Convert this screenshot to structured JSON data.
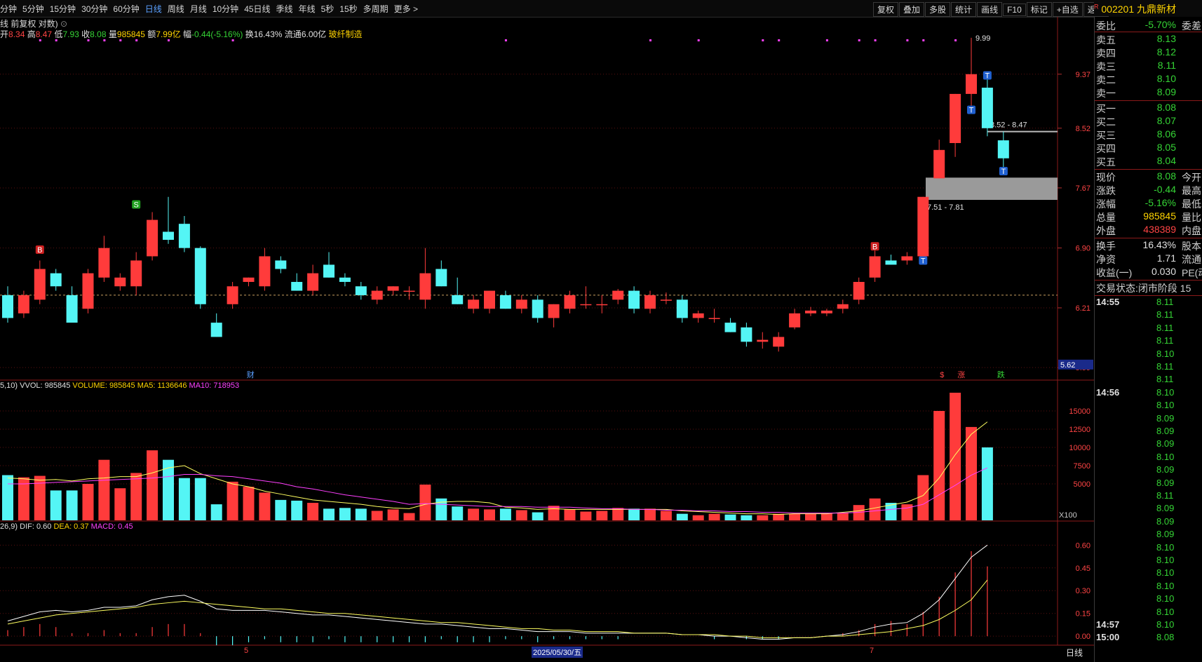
{
  "toolbar": {
    "periods": [
      "分钟",
      "5分钟",
      "15分钟",
      "30分钟",
      "60分钟",
      "日线",
      "周线",
      "月线",
      "10分钟",
      "45日线",
      "季线",
      "年线",
      "5秒",
      "15秒",
      "多周期",
      "更多 >"
    ],
    "active_period": "日线",
    "tools": [
      "复权",
      "叠加",
      "多股",
      "统计",
      "画线",
      "F10",
      "标记",
      "+自选",
      "返回"
    ]
  },
  "stock": {
    "code": "002201",
    "name": "九鼎新材",
    "badge": "R"
  },
  "chart_header": {
    "title": "线 前复权 对数)",
    "open_label": "开",
    "open": "8.34",
    "high_label": "高",
    "high": "8.47",
    "low_label": "低",
    "low": "7.93",
    "close_label": "收",
    "close": "8.08",
    "vol_label": "量",
    "vol": "985845",
    "amt_label": "额",
    "amt": "7.99亿",
    "chg_label": "幅",
    "chg": "-0.44(-5.16%)",
    "turn_label": "换",
    "turn": "16.43%",
    "float_label": "流通",
    "float": "6.00亿",
    "sector": "玻纤制造"
  },
  "vol_header": {
    "prefix": "5,10)",
    "vvol": "VVOL: 985845",
    "volume": "VOLUME: 985845",
    "ma5": "MA5: 1136646",
    "ma10": "MA10: 718953"
  },
  "macd_header": {
    "prefix": "26,9)",
    "dif": "DIF: 0.60",
    "dea": "DEA: 0.37",
    "macd": "MACD: 0.45"
  },
  "price_axis": [
    "9.37",
    "8.52",
    "7.67",
    "6.90",
    "6.21",
    "5.59"
  ],
  "price_marker": "5.62",
  "vol_axis": [
    "15000",
    "12500",
    "10000",
    "7500",
    "5000"
  ],
  "vol_unit": "X100",
  "macd_axis": [
    "0.60",
    "0.45",
    "0.30",
    "0.15",
    "0.00"
  ],
  "annotations": {
    "peak": "9.99",
    "zone_upper": "8.52 - 8.47",
    "zone_lower": "7.51 - 7.81",
    "markers_bottom": [
      "财",
      "$",
      "涨",
      "跌"
    ]
  },
  "x_labels": [
    "5",
    "2025/05/30/五",
    "7"
  ],
  "bottom_tabs_right": "日线",
  "quote": {
    "weibi_label": "委比",
    "weibi": "-5.70%",
    "weicha_label": "委差",
    "asks": [
      {
        "label": "卖五",
        "price": "8.13"
      },
      {
        "label": "卖四",
        "price": "8.12"
      },
      {
        "label": "卖三",
        "price": "8.11"
      },
      {
        "label": "卖二",
        "price": "8.10"
      },
      {
        "label": "卖一",
        "price": "8.09"
      }
    ],
    "bids": [
      {
        "label": "买一",
        "price": "8.08"
      },
      {
        "label": "买二",
        "price": "8.07"
      },
      {
        "label": "买三",
        "price": "8.06"
      },
      {
        "label": "买四",
        "price": "8.05"
      },
      {
        "label": "买五",
        "price": "8.04"
      }
    ],
    "stats": [
      {
        "label": "现价",
        "value": "8.08",
        "color": "#35d435",
        "right": "今开"
      },
      {
        "label": "涨跌",
        "value": "-0.44",
        "color": "#35d435",
        "right": "最高"
      },
      {
        "label": "涨幅",
        "value": "-5.16%",
        "color": "#35d435",
        "right": "最低"
      },
      {
        "label": "总量",
        "value": "985845",
        "color": "#ffd400",
        "right": "量比"
      },
      {
        "label": "外盘",
        "value": "438389",
        "color": "#ff4444",
        "right": "内盘"
      }
    ],
    "stats2": [
      {
        "label": "换手",
        "value": "16.43%",
        "color": "#e0e0e0",
        "right": "股本"
      },
      {
        "label": "净资",
        "value": "1.71",
        "color": "#e0e0e0",
        "right": "流通"
      },
      {
        "label": "收益(一)",
        "value": "0.030",
        "color": "#e0e0e0",
        "right": "PE(动"
      }
    ],
    "trade_status_label": "交易状态:",
    "trade_status": "闭市阶段 15"
  },
  "ticks": [
    {
      "time": "14:55",
      "price": "8.11"
    },
    {
      "time": "",
      "price": "8.11"
    },
    {
      "time": "",
      "price": "8.11"
    },
    {
      "time": "",
      "price": "8.11"
    },
    {
      "time": "",
      "price": "8.10"
    },
    {
      "time": "",
      "price": "8.11"
    },
    {
      "time": "",
      "price": "8.11"
    },
    {
      "time": "14:56",
      "price": "8.10"
    },
    {
      "time": "",
      "price": "8.10"
    },
    {
      "time": "",
      "price": "8.09"
    },
    {
      "time": "",
      "price": "8.09"
    },
    {
      "time": "",
      "price": "8.09"
    },
    {
      "time": "",
      "price": "8.10"
    },
    {
      "time": "",
      "price": "8.09"
    },
    {
      "time": "",
      "price": "8.09"
    },
    {
      "time": "",
      "price": "8.11"
    },
    {
      "time": "",
      "price": "8.09"
    },
    {
      "time": "",
      "price": "8.09"
    },
    {
      "time": "",
      "price": "8.09"
    },
    {
      "time": "",
      "price": "8.10"
    },
    {
      "time": "",
      "price": "8.10"
    },
    {
      "time": "",
      "price": "8.10"
    },
    {
      "time": "",
      "price": "8.10"
    },
    {
      "time": "",
      "price": "8.10"
    },
    {
      "time": "",
      "price": "8.10"
    },
    {
      "time": "14:57",
      "price": "8.10"
    },
    {
      "time": "15:00",
      "price": "8.08"
    }
  ],
  "chart_data": {
    "type": "candlestick",
    "candles": [
      {
        "o": 6.35,
        "h": 6.45,
        "l": 6.05,
        "c": 6.1
      },
      {
        "o": 6.15,
        "h": 6.4,
        "l": 6.1,
        "c": 6.35
      },
      {
        "o": 6.3,
        "h": 6.75,
        "l": 6.25,
        "c": 6.65
      },
      {
        "o": 6.6,
        "h": 6.65,
        "l": 6.4,
        "c": 6.45
      },
      {
        "o": 6.35,
        "h": 6.45,
        "l": 6.1,
        "c": 6.05
      },
      {
        "o": 6.2,
        "h": 6.65,
        "l": 6.15,
        "c": 6.6
      },
      {
        "o": 6.55,
        "h": 7.05,
        "l": 6.5,
        "c": 6.9
      },
      {
        "o": 6.45,
        "h": 6.6,
        "l": 6.4,
        "c": 6.55
      },
      {
        "o": 6.45,
        "h": 6.85,
        "l": 6.35,
        "c": 6.75
      },
      {
        "o": 6.8,
        "h": 7.35,
        "l": 6.75,
        "c": 7.25
      },
      {
        "o": 7.1,
        "h": 7.55,
        "l": 6.95,
        "c": 7.0
      },
      {
        "o": 7.2,
        "h": 7.3,
        "l": 6.85,
        "c": 6.9
      },
      {
        "o": 6.9,
        "h": 6.92,
        "l": 6.2,
        "c": 6.25
      },
      {
        "o": 6.05,
        "h": 6.15,
        "l": 5.9,
        "c": 5.9
      },
      {
        "o": 6.25,
        "h": 6.5,
        "l": 6.2,
        "c": 6.45
      },
      {
        "o": 6.5,
        "h": 6.55,
        "l": 6.45,
        "c": 6.55
      },
      {
        "o": 6.45,
        "h": 6.9,
        "l": 6.4,
        "c": 6.8
      },
      {
        "o": 6.75,
        "h": 6.8,
        "l": 6.6,
        "c": 6.65
      },
      {
        "o": 6.5,
        "h": 6.6,
        "l": 6.4,
        "c": 6.4
      },
      {
        "o": 6.4,
        "h": 6.7,
        "l": 6.35,
        "c": 6.6
      },
      {
        "o": 6.7,
        "h": 6.85,
        "l": 6.55,
        "c": 6.55
      },
      {
        "o": 6.55,
        "h": 6.6,
        "l": 6.45,
        "c": 6.5
      },
      {
        "o": 6.45,
        "h": 6.5,
        "l": 6.3,
        "c": 6.35
      },
      {
        "o": 6.3,
        "h": 6.45,
        "l": 6.25,
        "c": 6.4
      },
      {
        "o": 6.4,
        "h": 6.45,
        "l": 6.35,
        "c": 6.45
      },
      {
        "o": 6.4,
        "h": 6.45,
        "l": 6.3,
        "c": 6.4
      },
      {
        "o": 6.3,
        "h": 6.9,
        "l": 6.2,
        "c": 6.6
      },
      {
        "o": 6.65,
        "h": 6.75,
        "l": 6.45,
        "c": 6.45
      },
      {
        "o": 6.35,
        "h": 6.55,
        "l": 6.25,
        "c": 6.25
      },
      {
        "o": 6.2,
        "h": 6.35,
        "l": 6.15,
        "c": 6.3
      },
      {
        "o": 6.2,
        "h": 6.4,
        "l": 6.15,
        "c": 6.4
      },
      {
        "o": 6.35,
        "h": 6.4,
        "l": 6.2,
        "c": 6.2
      },
      {
        "o": 6.2,
        "h": 6.35,
        "l": 6.15,
        "c": 6.3
      },
      {
        "o": 6.3,
        "h": 6.35,
        "l": 6.05,
        "c": 6.1
      },
      {
        "o": 6.1,
        "h": 6.25,
        "l": 6.0,
        "c": 6.25
      },
      {
        "o": 6.2,
        "h": 6.4,
        "l": 6.15,
        "c": 6.35
      },
      {
        "o": 6.25,
        "h": 6.45,
        "l": 6.2,
        "c": 6.25
      },
      {
        "o": 6.25,
        "h": 6.35,
        "l": 6.15,
        "c": 6.25
      },
      {
        "o": 6.3,
        "h": 6.42,
        "l": 6.25,
        "c": 6.4
      },
      {
        "o": 6.4,
        "h": 6.45,
        "l": 6.15,
        "c": 6.2
      },
      {
        "o": 6.2,
        "h": 6.4,
        "l": 6.15,
        "c": 6.35
      },
      {
        "o": 6.3,
        "h": 6.38,
        "l": 6.25,
        "c": 6.3
      },
      {
        "o": 6.3,
        "h": 6.35,
        "l": 6.05,
        "c": 6.1
      },
      {
        "o": 6.1,
        "h": 6.18,
        "l": 6.05,
        "c": 6.15
      },
      {
        "o": 6.1,
        "h": 6.2,
        "l": 6.05,
        "c": 6.1
      },
      {
        "o": 6.05,
        "h": 6.1,
        "l": 5.95,
        "c": 5.95
      },
      {
        "o": 6.0,
        "h": 6.05,
        "l": 5.8,
        "c": 5.85
      },
      {
        "o": 5.85,
        "h": 5.95,
        "l": 5.78,
        "c": 5.87
      },
      {
        "o": 5.8,
        "h": 5.95,
        "l": 5.75,
        "c": 5.9
      },
      {
        "o": 6.0,
        "h": 6.2,
        "l": 5.98,
        "c": 6.15
      },
      {
        "o": 6.15,
        "h": 6.22,
        "l": 6.12,
        "c": 6.18
      },
      {
        "o": 6.15,
        "h": 6.2,
        "l": 6.12,
        "c": 6.18
      },
      {
        "o": 6.2,
        "h": 6.3,
        "l": 6.15,
        "c": 6.25
      },
      {
        "o": 6.3,
        "h": 6.55,
        "l": 6.25,
        "c": 6.5
      },
      {
        "o": 6.55,
        "h": 6.9,
        "l": 6.5,
        "c": 6.8
      },
      {
        "o": 6.75,
        "h": 6.82,
        "l": 6.7,
        "c": 6.7
      },
      {
        "o": 6.75,
        "h": 6.85,
        "l": 6.7,
        "c": 6.8
      },
      {
        "o": 6.8,
        "h": 7.55,
        "l": 6.7,
        "c": 7.55
      },
      {
        "o": 7.8,
        "h": 8.35,
        "l": 7.8,
        "c": 8.2
      },
      {
        "o": 8.3,
        "h": 9.05,
        "l": 8.1,
        "c": 9.05
      },
      {
        "o": 9.05,
        "h": 9.99,
        "l": 8.75,
        "c": 9.37
      },
      {
        "o": 9.15,
        "h": 9.35,
        "l": 8.4,
        "c": 8.52
      },
      {
        "o": 8.34,
        "h": 8.47,
        "l": 7.93,
        "c": 8.08
      }
    ],
    "volumes": [
      6200,
      5900,
      6100,
      4100,
      4100,
      5000,
      8300,
      4400,
      6500,
      9600,
      8300,
      5800,
      5800,
      2200,
      5300,
      4600,
      3800,
      2800,
      2700,
      2400,
      1600,
      1700,
      1600,
      1300,
      1500,
      1000,
      4900,
      3000,
      1900,
      1600,
      1500,
      1600,
      1400,
      1100,
      2000,
      1500,
      1200,
      1300,
      1700,
      1600,
      1600,
      1300,
      900,
      700,
      900,
      800,
      700,
      700,
      900,
      900,
      900,
      1000,
      1000,
      2100,
      3000,
      2400,
      2200,
      6200,
      15000,
      17500,
      12800,
      10000
    ],
    "vol_ma5": [
      5800,
      5700,
      5500,
      5600,
      5400,
      5700,
      5800,
      6000,
      6000,
      6500,
      7200,
      7500,
      6400,
      5700,
      5000,
      4600,
      4000,
      3600,
      3200,
      2800,
      2600,
      2400,
      2200,
      1900,
      1700,
      1600,
      2200,
      2500,
      2600,
      2600,
      2400,
      1800,
      1700,
      1500,
      1600,
      1500,
      1500,
      1500,
      1500,
      1500,
      1500,
      1500,
      1300,
      1200,
      1100,
      1000,
      900,
      900,
      800,
      900,
      900,
      900,
      1100,
      1300,
      1700,
      2100,
      2500,
      3400,
      5800,
      9000,
      11800,
      13500
    ],
    "vol_ma10": [
      5000,
      5000,
      5100,
      5200,
      5300,
      5400,
      5500,
      5600,
      5700,
      5800,
      6000,
      6300,
      6300,
      6100,
      6000,
      5700,
      5400,
      5100,
      4600,
      4300,
      3900,
      3500,
      3200,
      2900,
      2600,
      2200,
      2300,
      2200,
      2100,
      2000,
      1900,
      1900,
      1900,
      1800,
      1800,
      1800,
      1700,
      1600,
      1600,
      1500,
      1500,
      1400,
      1400,
      1300,
      1300,
      1200,
      1200,
      1100,
      1100,
      1000,
      1000,
      1000,
      1000,
      1100,
      1300,
      1500,
      1700,
      2200,
      3500,
      4800,
      6200,
      7200
    ],
    "macd_dif": [
      0.1,
      0.13,
      0.16,
      0.17,
      0.16,
      0.17,
      0.19,
      0.19,
      0.2,
      0.24,
      0.26,
      0.27,
      0.23,
      0.18,
      0.17,
      0.17,
      0.17,
      0.16,
      0.15,
      0.14,
      0.14,
      0.13,
      0.12,
      0.11,
      0.1,
      0.09,
      0.08,
      0.08,
      0.07,
      0.06,
      0.05,
      0.05,
      0.04,
      0.03,
      0.03,
      0.03,
      0.02,
      0.02,
      0.02,
      0.02,
      0.02,
      0.02,
      0.01,
      0.01,
      0.0,
      0.0,
      -0.01,
      -0.02,
      -0.02,
      -0.01,
      -0.01,
      0.0,
      0.01,
      0.03,
      0.06,
      0.08,
      0.09,
      0.15,
      0.24,
      0.38,
      0.52,
      0.6
    ],
    "macd_dea": [
      0.08,
      0.1,
      0.12,
      0.14,
      0.15,
      0.16,
      0.17,
      0.18,
      0.19,
      0.21,
      0.22,
      0.23,
      0.22,
      0.21,
      0.2,
      0.19,
      0.18,
      0.18,
      0.17,
      0.16,
      0.15,
      0.15,
      0.14,
      0.13,
      0.12,
      0.11,
      0.1,
      0.09,
      0.09,
      0.08,
      0.07,
      0.06,
      0.05,
      0.05,
      0.04,
      0.04,
      0.03,
      0.03,
      0.03,
      0.02,
      0.02,
      0.02,
      0.01,
      0.01,
      0.01,
      0.0,
      0.0,
      -0.01,
      -0.01,
      -0.01,
      -0.01,
      0.0,
      0.0,
      0.01,
      0.02,
      0.03,
      0.05,
      0.07,
      0.11,
      0.17,
      0.24,
      0.37
    ],
    "ylim_price": [
      5.55,
      10.1
    ],
    "ylim_vol": [
      0,
      17500
    ],
    "ylim_macd": [
      -0.05,
      0.68
    ]
  }
}
